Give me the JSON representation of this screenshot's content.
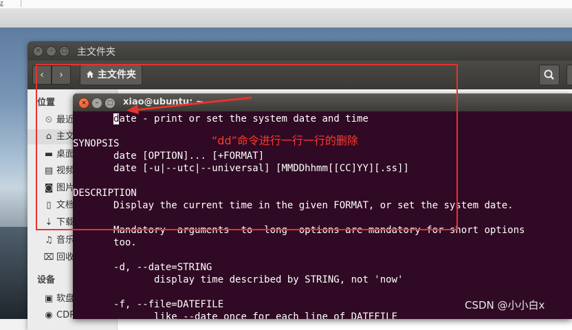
{
  "top_bar": {
    "corner_glyph": "z"
  },
  "file_manager": {
    "title": "主文件夹",
    "back_icon": "‹",
    "forward_icon": "›",
    "path_label": "主文件夹",
    "sidebar": {
      "places_header": "位置",
      "devices_header": "设备",
      "places": [
        {
          "icon": "clock-icon",
          "label": "最近"
        },
        {
          "icon": "home-icon",
          "label": "主文"
        },
        {
          "icon": "folder-icon",
          "label": "桌面"
        },
        {
          "icon": "film-icon",
          "label": "视频"
        },
        {
          "icon": "camera-icon",
          "label": "图片"
        },
        {
          "icon": "document-icon",
          "label": "文档"
        },
        {
          "icon": "download-icon",
          "label": "下载"
        },
        {
          "icon": "music-icon",
          "label": "音乐"
        },
        {
          "icon": "trash-icon",
          "label": "回收"
        }
      ],
      "devices": [
        {
          "icon": "disk-icon",
          "label": "软盘"
        },
        {
          "icon": "disc-icon",
          "label": "CDR"
        }
      ]
    }
  },
  "terminal": {
    "title": "xiao@ubuntu: ~",
    "lines": [
      {
        "indent": "       ",
        "cursor_char": "d",
        "text": "ate - print or set the system date and time"
      },
      {
        "indent": "",
        "cursor_char": "",
        "text": ""
      },
      {
        "indent": "",
        "cursor_char": "",
        "text": "SYNOPSIS"
      },
      {
        "indent": "       ",
        "cursor_char": "",
        "text": "date [OPTION]... [+FORMAT]"
      },
      {
        "indent": "       ",
        "cursor_char": "",
        "text": "date [-u|--utc|--universal] [MMDDhhmm[[CC]YY][.ss]]"
      },
      {
        "indent": "",
        "cursor_char": "",
        "text": ""
      },
      {
        "indent": "",
        "cursor_char": "",
        "text": "DESCRIPTION"
      },
      {
        "indent": "       ",
        "cursor_char": "",
        "text": "Display the current time in the given FORMAT, or set the system date."
      },
      {
        "indent": "",
        "cursor_char": "",
        "text": ""
      },
      {
        "indent": "       ",
        "cursor_char": "",
        "text": "Mandatory  arguments  to  long  options are mandatory for short options"
      },
      {
        "indent": "       ",
        "cursor_char": "",
        "text": "too."
      },
      {
        "indent": "",
        "cursor_char": "",
        "text": ""
      },
      {
        "indent": "       ",
        "cursor_char": "",
        "text": "-d, --date=STRING"
      },
      {
        "indent": "              ",
        "cursor_char": "",
        "text": "display time described by STRING, not 'now'"
      },
      {
        "indent": "",
        "cursor_char": "",
        "text": ""
      },
      {
        "indent": "       ",
        "cursor_char": "",
        "text": "-f, --file=DATEFILE"
      },
      {
        "indent": "              ",
        "cursor_char": "",
        "text": "like --date once for each line of DATEFILE"
      }
    ]
  },
  "annotation": {
    "text": "“dd”命令进行一行一行的删除",
    "color": "#e8322e"
  },
  "watermark": "CSDN @小小白x"
}
